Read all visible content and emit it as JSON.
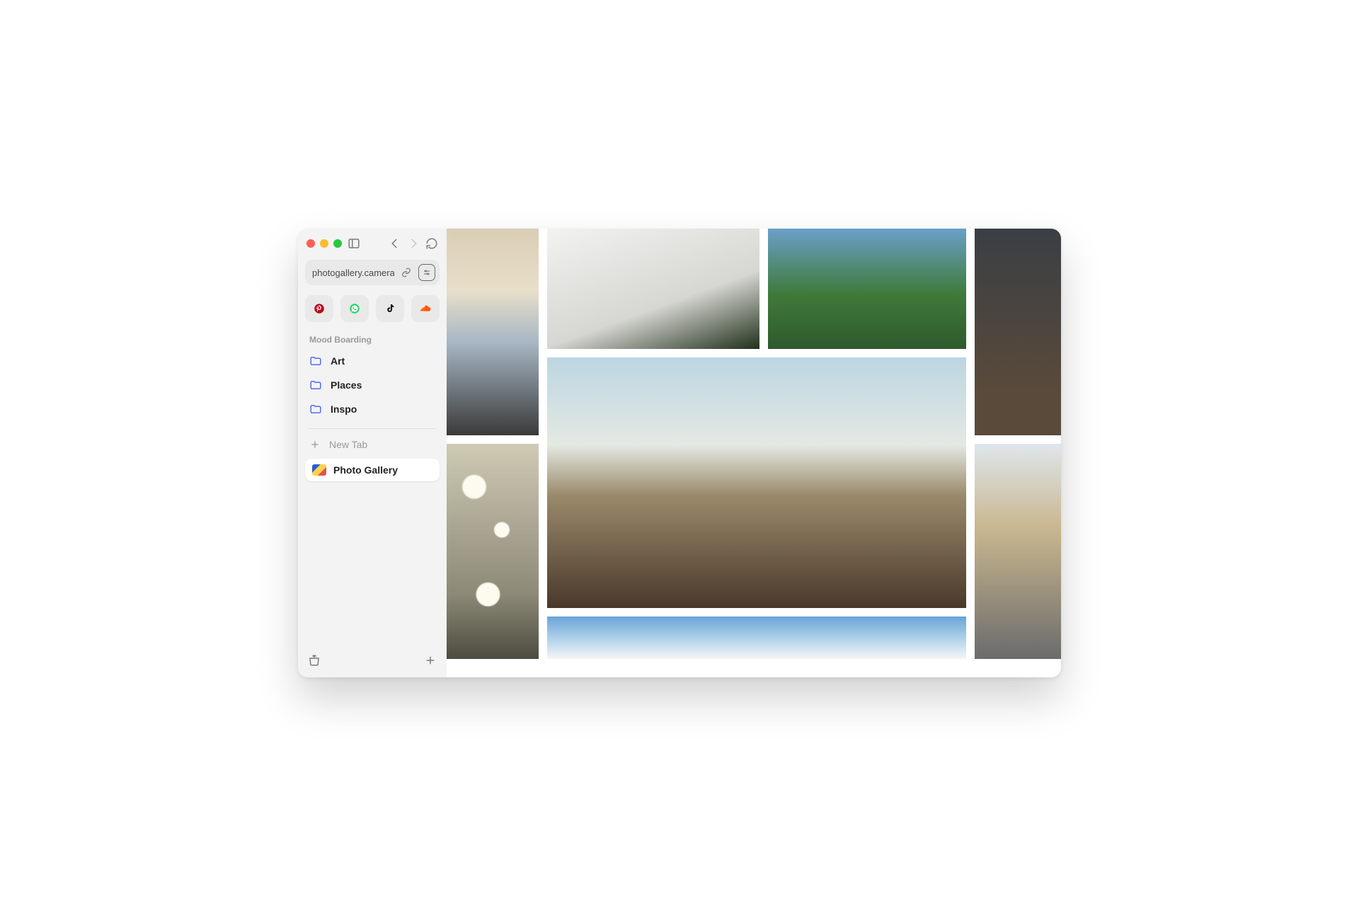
{
  "url": "photogallery.camera",
  "pinned_sites": [
    {
      "name": "pinterest",
      "color": "#bd081c"
    },
    {
      "name": "whatsapp",
      "color": "#25d366"
    },
    {
      "name": "tiktok",
      "color": "#000000"
    },
    {
      "name": "soundcloud",
      "color": "#ff5500"
    }
  ],
  "section_label": "Mood Boarding",
  "folders": [
    {
      "label": "Art"
    },
    {
      "label": "Places"
    },
    {
      "label": "Inspo"
    }
  ],
  "new_tab_label": "New Tab",
  "active_tab": {
    "label": "Photo Gallery"
  }
}
